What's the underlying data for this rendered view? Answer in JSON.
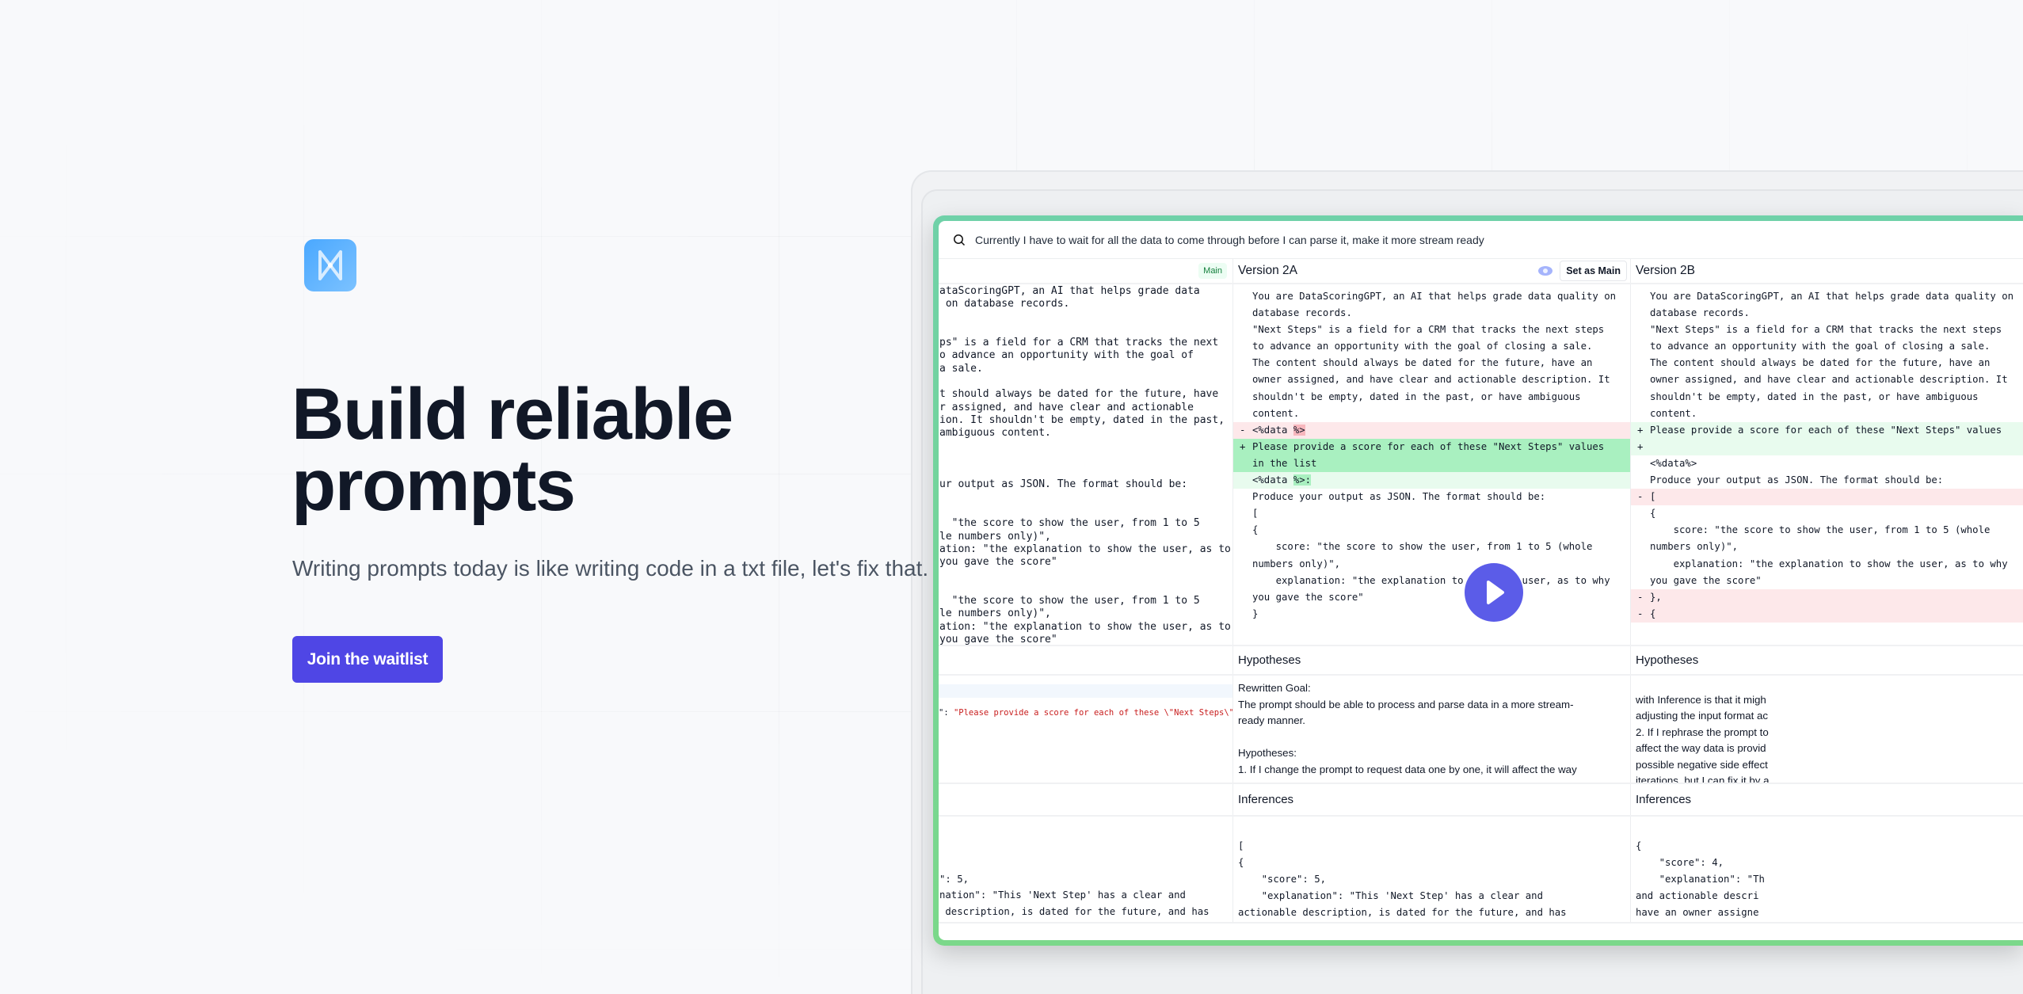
{
  "hero": {
    "logo_icon": "m-logo-icon",
    "title_line1": "Build reliable",
    "title_line2": "prompts",
    "subtitle": "Writing prompts today is like writing code in a txt file, let's fix that.",
    "cta_label": "Join the waitlist",
    "accent": "#4f46e5"
  },
  "app": {
    "search_icon": "search-icon",
    "search_text": "Currently I have to wait for all the data to come through before I can parse it, make it more stream ready",
    "main_badge": "Main",
    "version_a": "Version 2A",
    "version_b": "Version 2B",
    "eye_icon": "eye-icon",
    "set_main_label": "Set as Main",
    "hypotheses_label": "Hypotheses",
    "inferences_label": "Inferences",
    "play_icon": "play-icon",
    "colors": {
      "border": "#6fd1a8",
      "added": "#a9f0c0",
      "removed": "#fde8ea",
      "play": "#5b5ce8"
    },
    "prompt_main": [
      "ataScoringGPT, an AI that helps grade data",
      " on database records.",
      "",
      "",
      "ps\" is a field for a CRM that tracks the next",
      "o advance an opportunity with the goal of",
      "a sale.",
      "",
      "t should always be dated for the future, have",
      "r assigned, and have clear and actionable",
      "ion. It shouldn't be empty, dated in the past,",
      "ambiguous content.",
      "",
      "",
      "",
      "ur output as JSON. The format should be:",
      "",
      "",
      "  \"the score to show the user, from 1 to 5",
      "le numbers only)\",",
      "ation: \"the explanation to show the user, as to",
      "you gave the score\"",
      "",
      "",
      "  \"the score to show the user, from 1 to 5",
      "le numbers only)\",",
      "ation: \"the explanation to show the user, as to",
      "you gave the score\""
    ],
    "prompt_a": [
      {
        "t": "You are DataScoringGPT, an AI that helps grade data quality on"
      },
      {
        "t": "database records."
      },
      {
        "t": "\"Next Steps\" is a field for a CRM that tracks the next steps"
      },
      {
        "t": "to advance an opportunity with the goal of closing a sale."
      },
      {
        "t": "The content should always be dated for the future, have an"
      },
      {
        "t": "owner assigned, and have clear and actionable description. It"
      },
      {
        "t": "shouldn't be empty, dated in the past, or have ambiguous"
      },
      {
        "t": "content."
      },
      {
        "k": "del",
        "s": "-",
        "t": "<%data ",
        "m": "%>"
      },
      {
        "k": "add",
        "s": "+",
        "t": "Please provide a score for each of these \"Next Steps\" values"
      },
      {
        "k": "add",
        "t": "in the list"
      },
      {
        "k": "addl",
        "t": "<%data ",
        "m": "%>:"
      },
      {
        "t": "Produce your output as JSON. The format should be:"
      },
      {
        "t": "["
      },
      {
        "t": "{"
      },
      {
        "t": "    score: \"the score to show the user, from 1 to 5 (whole"
      },
      {
        "t": "numbers only)\","
      },
      {
        "t": "    explanation: \"the explanation to show the user, as to why"
      },
      {
        "t": "you gave the score\""
      },
      {
        "t": "}"
      }
    ],
    "prompt_b": [
      {
        "t": "You are DataScoringGPT, an AI that helps grade data quality on"
      },
      {
        "t": "database records."
      },
      {
        "t": "\"Next Steps\" is a field for a CRM that tracks the next steps"
      },
      {
        "t": "to advance an opportunity with the goal of closing a sale."
      },
      {
        "t": "The content should always be dated for the future, have an"
      },
      {
        "t": "owner assigned, and have clear and actionable description. It"
      },
      {
        "t": "shouldn't be empty, dated in the past, or have ambiguous"
      },
      {
        "t": "content."
      },
      {
        "k": "addl",
        "s": "+",
        "t": "Please provide a score for each of these \"Next Steps\" values"
      },
      {
        "k": "addl",
        "s": "+",
        "t": ""
      },
      {
        "t": "<%data%>"
      },
      {
        "t": "Produce your output as JSON. The format should be:"
      },
      {
        "k": "del",
        "s": "-",
        "t": "["
      },
      {
        "t": "{"
      },
      {
        "t": "    score: \"the score to show the user, from 1 to 5 (whole"
      },
      {
        "t": "numbers only)\","
      },
      {
        "t": "    explanation: \"the explanation to show the user, as to why"
      },
      {
        "t": "you gave the score\""
      },
      {
        "k": "del",
        "s": "-",
        "t": "},"
      },
      {
        "k": "del",
        "s": "-",
        "t": "{"
      }
    ],
    "hyp_main_prefix": "\": ",
    "hyp_main_string": "\"Please provide a score for each of these \\\"Next Steps\\\"",
    "hyp_a": "Rewritten Goal:\nThe prompt should be able to process and parse data in a more stream-\nready manner.\n\nHypotheses:\n1. If I change the prompt to request data one by one, it will affect the way",
    "hyp_b": "\nwith Inference is that it migh\nadjusting the input format ac\n2. If I rephrase the prompt to\naffect the way data is provid\npossible negative side effect\niterations, but I can fix it by a",
    "inf_main": [
      "",
      "",
      "\": 5,",
      "nation\": \"This 'Next Step' has a clear and",
      " description, is dated for the future, and has"
    ],
    "inf_a": [
      "[",
      "{",
      "    \"score\": 5,",
      "    \"explanation\": \"This 'Next Step' has a clear and",
      "actionable description, is dated for the future, and has"
    ],
    "inf_b": [
      "{",
      "    \"score\": 4,",
      "    \"explanation\": \"Th",
      "and actionable descri",
      "have an owner assigne"
    ]
  }
}
